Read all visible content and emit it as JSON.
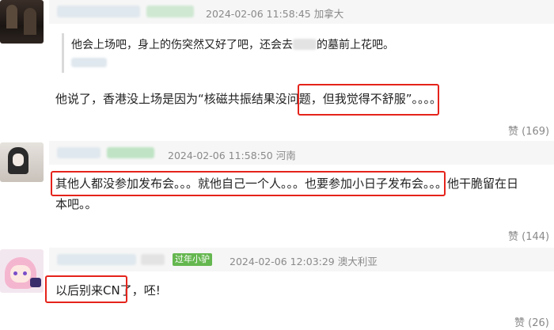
{
  "comments": [
    {
      "timestamp": "2024-02-06 11:58:45",
      "location": "加拿大",
      "quote_text": "他会上场吧，身上的伤突然又好了吧，还会去",
      "quote_text_end": "的墓前上花吧。",
      "body": "他说了，香港没上场是因为“核磁共振结果没问题，但我觉得不舒服”。。。。",
      "likes": "赞 (169)"
    },
    {
      "timestamp": "2024-02-06 11:58:50",
      "location": "河南",
      "body_line1": "其他人都没参加发布会。。。就他自己一个人。。。也要参加小日子发布会。。。他干脆留在日",
      "body_line2": "本吧。。",
      "likes": "赞 (144)"
    },
    {
      "badge": "过年小驴",
      "timestamp": "2024-02-06 12:03:29",
      "location": "澳大利亚",
      "body": "以后别来CN了，呸!",
      "likes": "赞 (26)"
    }
  ],
  "colors": {
    "highlight_box": "#e5231b",
    "badge": "#65b74f",
    "meta": "#8a8a8a"
  }
}
